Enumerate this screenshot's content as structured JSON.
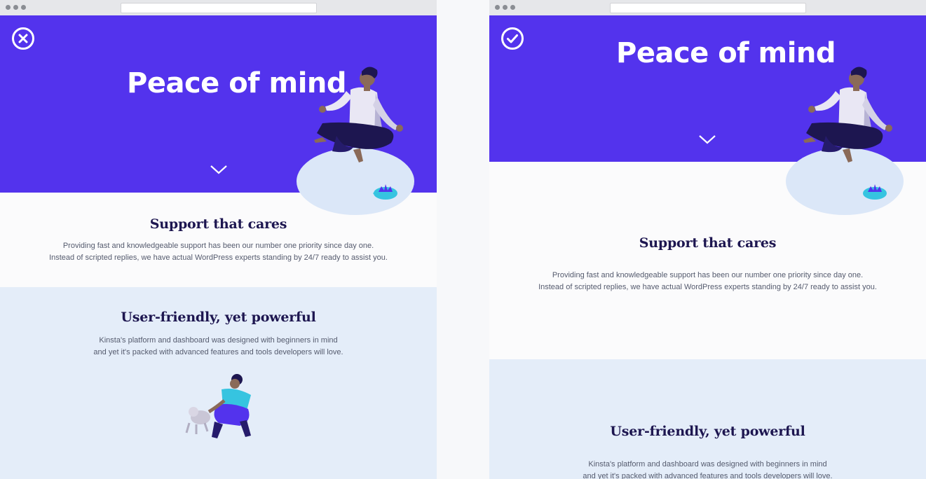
{
  "left": {
    "hero": {
      "title": "Peace of mind",
      "status_icon": "close-circle-icon",
      "scroll_icon": "chevron-down-icon"
    },
    "support": {
      "title": "Support that cares",
      "line1": "Providing fast and knowledgeable support has been our number one priority since day one.",
      "line2": "Instead of scripted replies, we have actual WordPress experts standing by 24/7 ready to assist you."
    },
    "features": {
      "title": "User-friendly, yet powerful",
      "line1": "Kinsta's platform and dashboard was designed with beginners in mind",
      "line2": "and yet it's packed with advanced features and tools developers will love."
    }
  },
  "right": {
    "hero": {
      "title": "Peace of mind",
      "status_icon": "checkmark-circle-icon",
      "scroll_icon": "chevron-down-icon"
    },
    "support": {
      "title": "Support that cares",
      "line1": "Providing fast and knowledgeable support has been our number one priority since day one.",
      "line2": "Instead of scripted replies, we have actual WordPress experts standing by 24/7 ready to assist you."
    },
    "features": {
      "title": "User-friendly, yet powerful",
      "line1": "Kinsta's platform and dashboard was designed with beginners in mind",
      "line2": "and yet it's packed with advanced features and tools developers will love."
    }
  },
  "colors": {
    "hero_purple": "#5333ed",
    "heading_navy": "#1d1650",
    "light_band": "#e4edf9",
    "mat_blue": "#dbe7f8",
    "accent_cyan": "#36c4e0"
  }
}
